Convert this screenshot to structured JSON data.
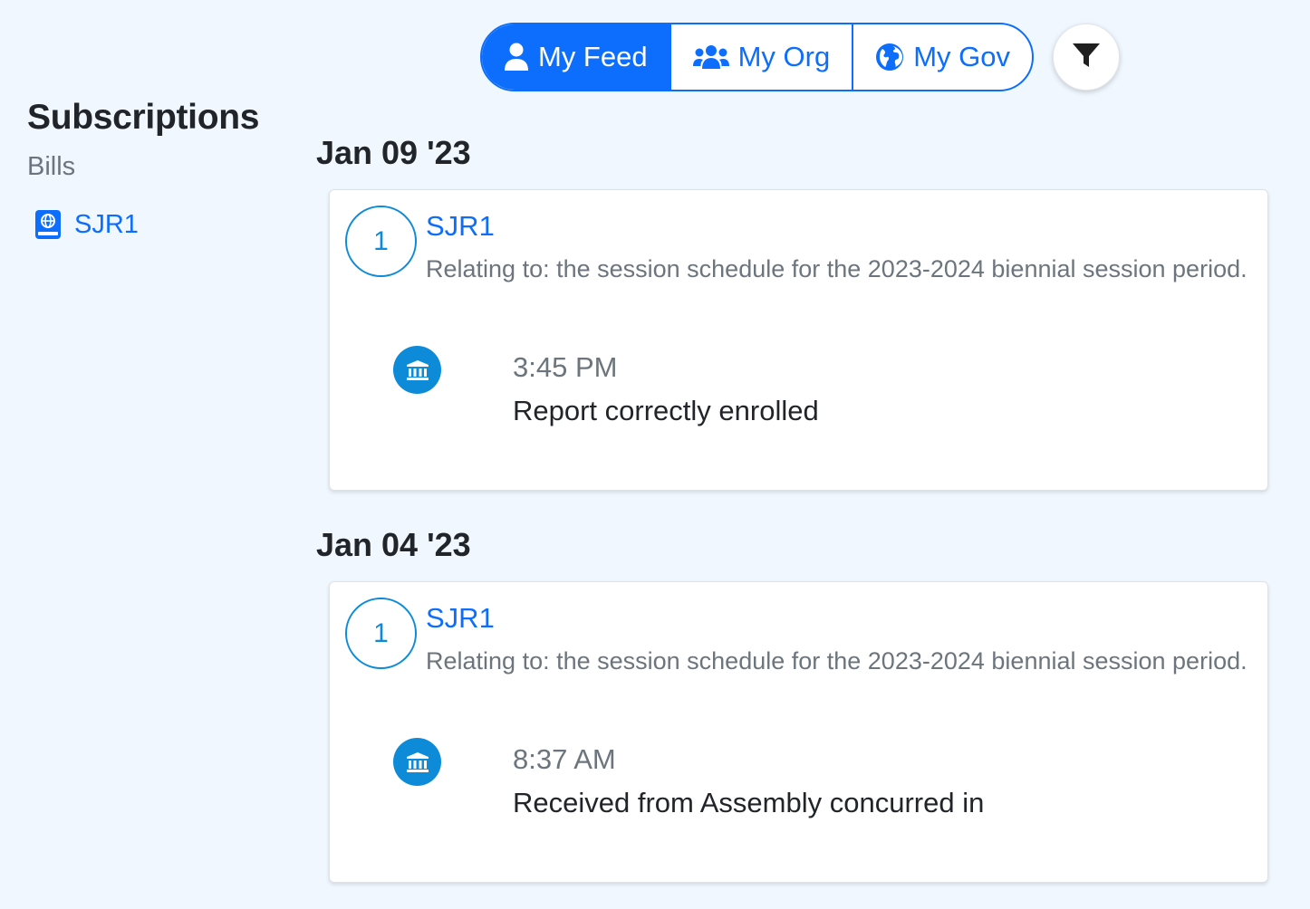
{
  "sidebar": {
    "title": "Subscriptions",
    "section_label": "Bills",
    "items": [
      {
        "label": "SJR1",
        "icon": "bill-book-icon"
      }
    ]
  },
  "tabs": {
    "items": [
      {
        "label": "My Feed",
        "icon": "user-icon",
        "active": true
      },
      {
        "label": "My Org",
        "icon": "users-icon",
        "active": false
      },
      {
        "label": "My Gov",
        "icon": "globe-icon",
        "active": false
      }
    ],
    "filter_icon": "filter-icon"
  },
  "feed": [
    {
      "date": "Jan 09 '23",
      "card": {
        "count": "1",
        "bill": "SJR1",
        "description": "Relating to: the session schedule for the 2023-2024 biennial session period.",
        "event_icon": "government-building-icon",
        "time": "3:45 PM",
        "action": "Report correctly enrolled"
      }
    },
    {
      "date": "Jan 04 '23",
      "card": {
        "count": "1",
        "bill": "SJR1",
        "description": "Relating to: the session schedule for the 2023-2024 biennial session period.",
        "event_icon": "government-building-icon",
        "time": "8:37 AM",
        "action": "Received from Assembly concurred in"
      }
    }
  ],
  "colors": {
    "background": "#f0f7ff",
    "primary": "#0d6efd",
    "accent": "#0d8bd9",
    "muted": "#6c757d"
  }
}
